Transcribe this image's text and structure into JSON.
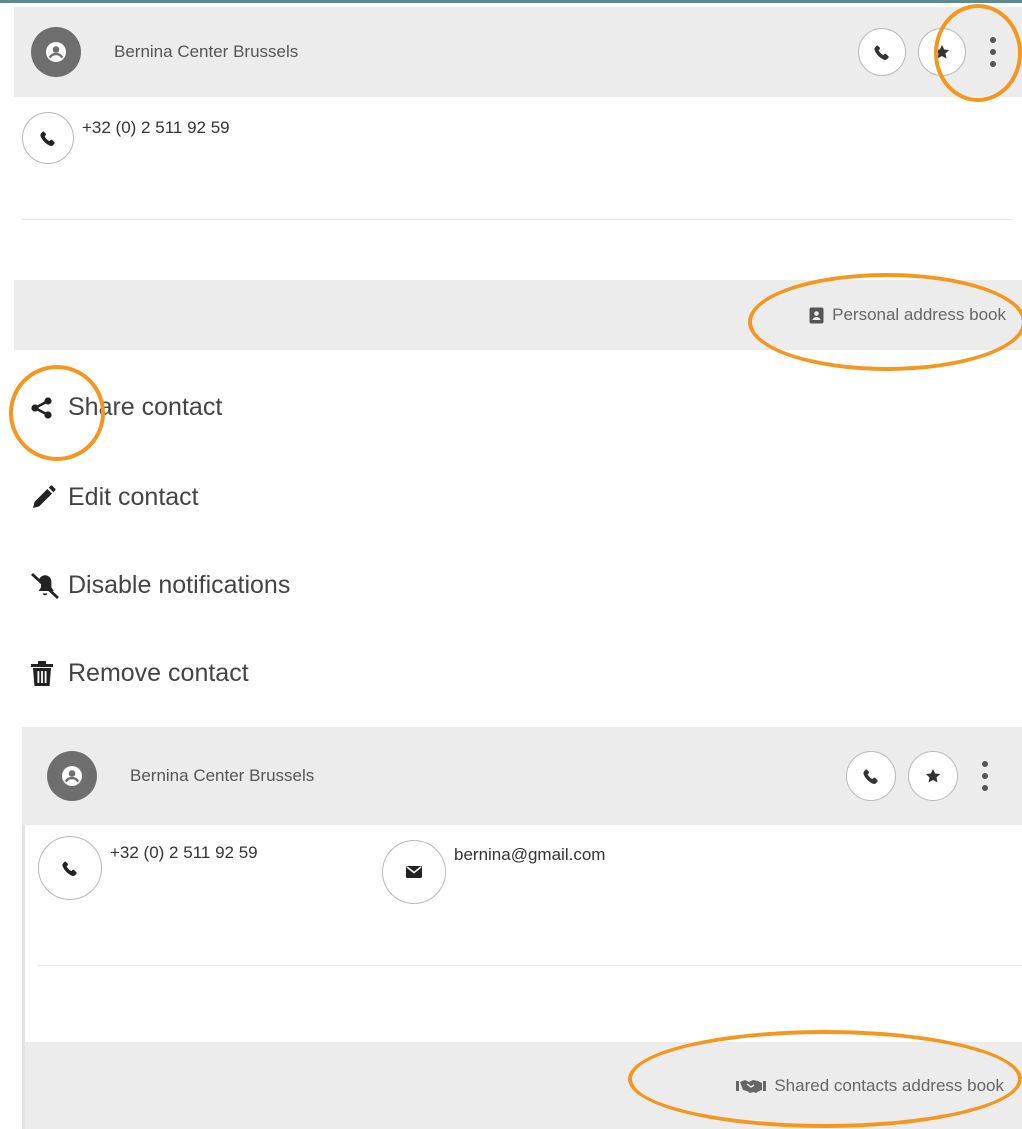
{
  "contact": {
    "name": "Bernina Center Brussels",
    "phone": "+32 (0) 2 511 92 59",
    "email": "bernina@gmail.com"
  },
  "personal_book": {
    "label": "Personal address book",
    "icon": "address-book-icon"
  },
  "shared_book": {
    "label": "Shared contacts address book",
    "icon": "handshake-icon"
  },
  "menu": {
    "items": [
      {
        "label": "Share contact",
        "icon": "share-icon"
      },
      {
        "label": "Edit contact",
        "icon": "pencil-icon"
      },
      {
        "label": "Disable notifications",
        "icon": "bell-slash-icon"
      },
      {
        "label": "Remove contact",
        "icon": "trash-icon"
      }
    ]
  },
  "colors": {
    "header_bg": "#ececec",
    "highlight": "#f5961e",
    "avatar_bg": "#6e6e6e",
    "accent_line": "#5b8a93"
  }
}
